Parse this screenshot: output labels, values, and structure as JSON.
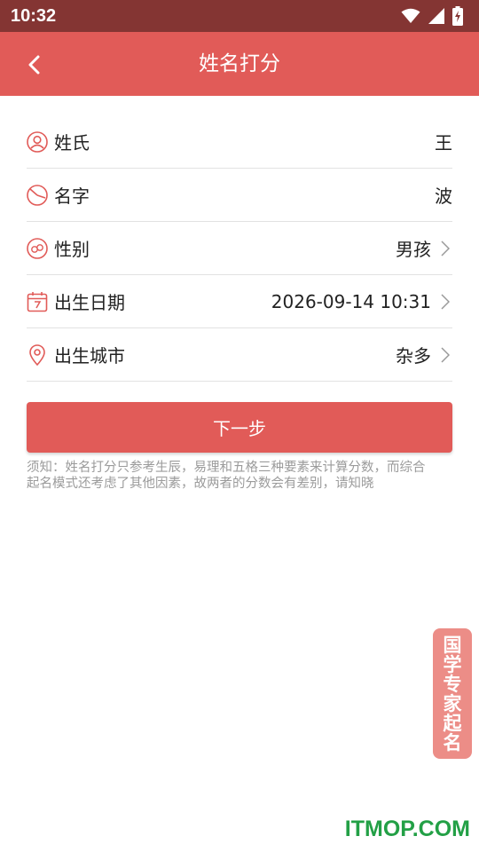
{
  "status_bar": {
    "time": "10:32"
  },
  "app_bar": {
    "title": "姓名打分"
  },
  "form": {
    "rows": [
      {
        "label": "姓氏",
        "value": "王",
        "icon": "person-icon"
      },
      {
        "label": "名字",
        "value": "波",
        "icon": "pie-icon"
      },
      {
        "label": "性别",
        "value": "男孩",
        "icon": "gender-icon"
      },
      {
        "label": "出生日期",
        "value": "2026-09-14 10:31",
        "icon": "calendar-icon"
      },
      {
        "label": "出生城市",
        "value": "杂多",
        "icon": "location-pin-icon"
      }
    ]
  },
  "next_button": {
    "label": "下一步"
  },
  "notice": "须知：姓名打分只参考生辰，易理和五格三种要素来计算分数，而综合起名模式还考虑了其他因素，故两者的分数会有差别，请知晓",
  "side_tag": {
    "chars": [
      "国",
      "学",
      "专",
      "家",
      "起",
      "名"
    ]
  },
  "watermark": "ITMOP.COM",
  "colors": {
    "accent": "#e15b58",
    "status_bar": "#843533",
    "watermark": "#23a046",
    "side_tag": "#ec8d87"
  }
}
